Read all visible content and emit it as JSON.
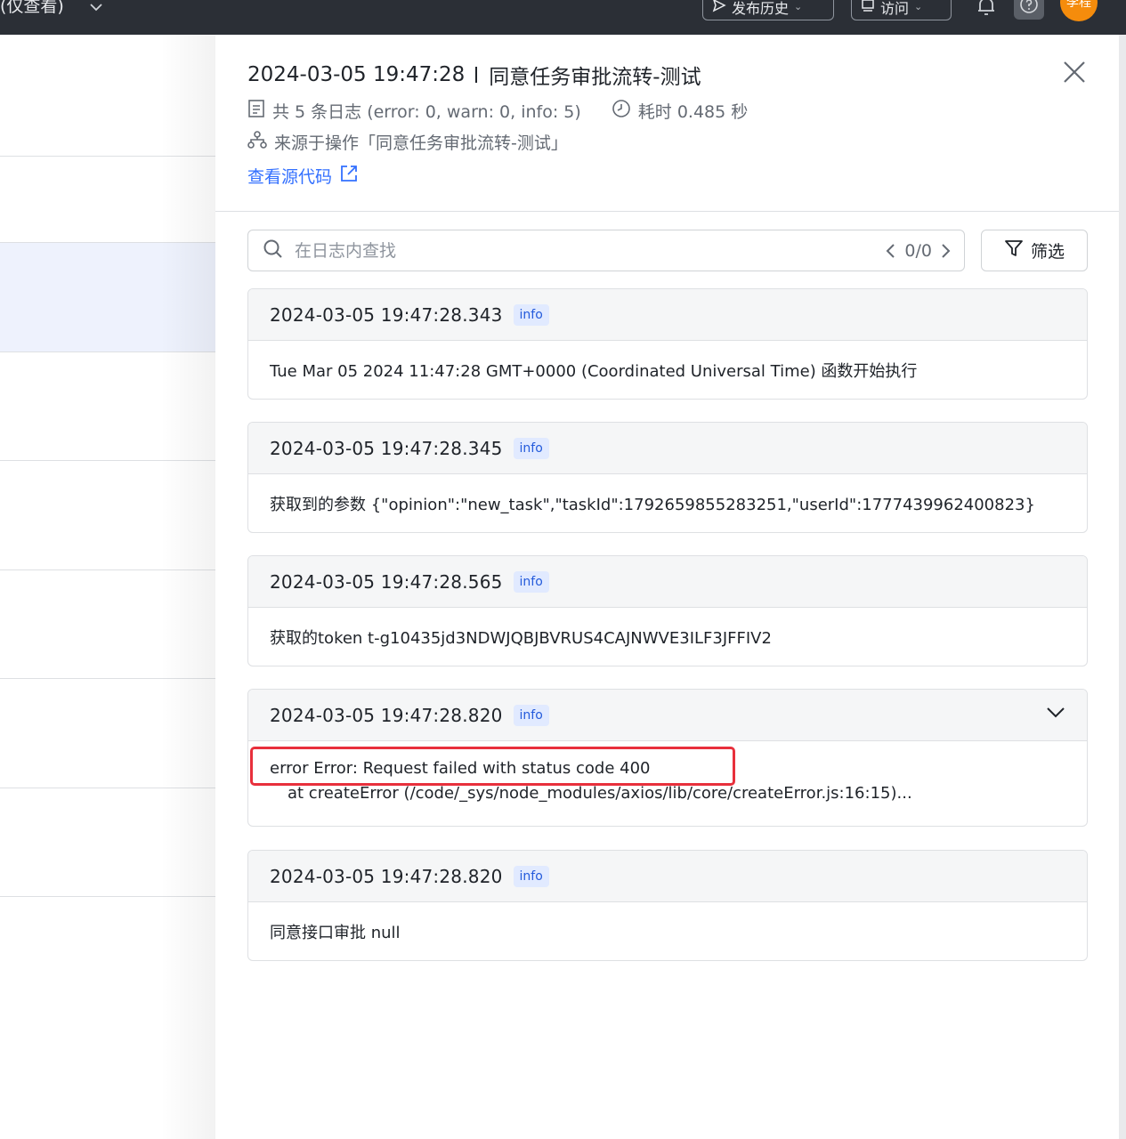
{
  "topbar": {
    "left_title": "(仅查看)",
    "publish_history_label": "发布历史",
    "visit_label": "访问",
    "avatar_text": "李程"
  },
  "drawer": {
    "title_time": "2024-03-05 19:47:28",
    "title_name": "同意任务审批流转-测试",
    "log_summary": "共 5 条日志 (error: 0, warn: 0, info: 5)",
    "duration": "耗时 0.485 秒",
    "source": "来源于操作「同意任务审批流转-测试」",
    "view_source_label": "查看源代码"
  },
  "search": {
    "placeholder": "在日志内查找",
    "counter": "0/0",
    "filter_label": "筛选"
  },
  "logs": [
    {
      "time": "2024-03-05 19:47:28.343",
      "level": "info",
      "message": "Tue Mar 05 2024 11:47:28 GMT+0000 (Coordinated Universal Time) 函数开始执行"
    },
    {
      "time": "2024-03-05 19:47:28.345",
      "level": "info",
      "message": "获取到的参数 {\"opinion\":\"new_task\",\"taskId\":1792659855283251,\"userId\":1777439962400823}"
    },
    {
      "time": "2024-03-05 19:47:28.565",
      "level": "info",
      "message": "获取的token t-g10435jd3NDWJQBJBVRUS4CAJNWVE3ILF3JFFIV2"
    },
    {
      "time": "2024-03-05 19:47:28.820",
      "level": "info",
      "message_line1": "error Error: Request failed with status code 400",
      "message_line2": "at createError (/code/_sys/node_modules/axios/lib/core/createError.js:16:15)..."
    },
    {
      "time": "2024-03-05 19:47:28.820",
      "level": "info",
      "message": "同意接口审批 null"
    }
  ],
  "colors": {
    "accent": "#3370ff",
    "badge_bg": "#e1eaff",
    "badge_text": "#245bdb",
    "highlight": "#e8303c",
    "avatar": "#f58c0c"
  }
}
